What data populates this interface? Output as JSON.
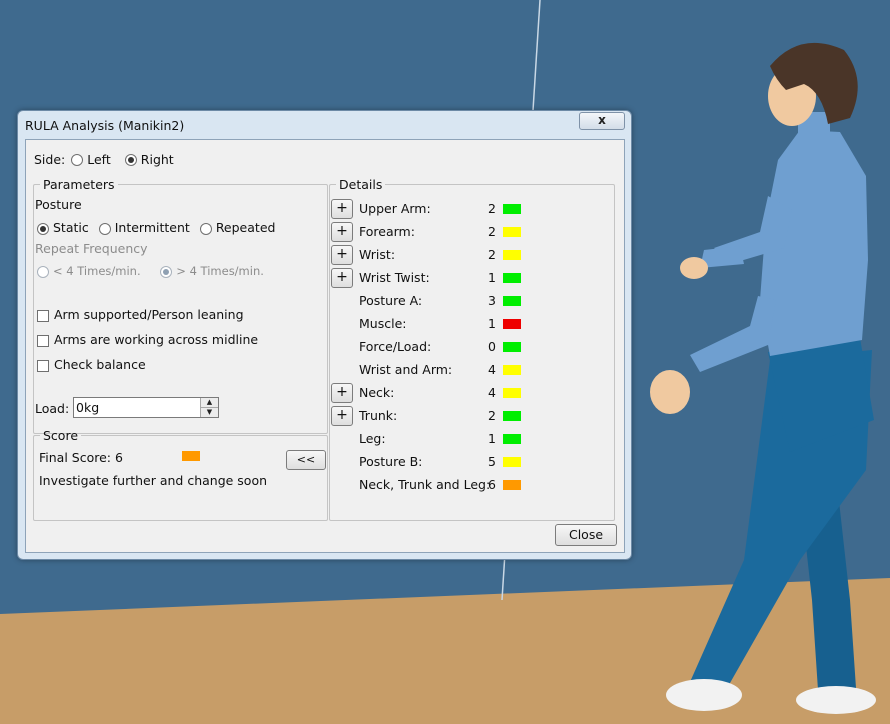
{
  "window": {
    "title": "RULA Analysis (Manikin2)",
    "close_glyph": "x"
  },
  "side": {
    "label": "Side:",
    "options": [
      "Left",
      "Right"
    ],
    "selected": "Right"
  },
  "parameters": {
    "legend": "Parameters",
    "posture_label": "Posture",
    "posture_options": [
      "Static",
      "Intermittent",
      "Repeated"
    ],
    "posture_selected": "Static",
    "repeat_frequency_label": "Repeat Frequency",
    "frequency_options": [
      "< 4 Times/min.",
      "> 4 Times/min."
    ],
    "frequency_selected": "> 4 Times/min.",
    "checkboxes": [
      {
        "label": "Arm supported/Person leaning",
        "checked": false
      },
      {
        "label": "Arms are working across midline",
        "checked": false
      },
      {
        "label": "Check balance",
        "checked": false
      }
    ],
    "load_label": "Load:",
    "load_value": "0kg"
  },
  "score": {
    "legend": "Score",
    "final_label": "Final Score: 6",
    "final_color": "#ff9900",
    "message": "Investigate further and change soon",
    "collapse_button": "<<"
  },
  "details": {
    "legend": "Details",
    "rows": [
      {
        "label": "Upper Arm:",
        "value": "2",
        "color": "#00ee00",
        "expandable": true
      },
      {
        "label": "Forearm:",
        "value": "2",
        "color": "#ffff00",
        "expandable": true
      },
      {
        "label": "Wrist:",
        "value": "2",
        "color": "#ffff00",
        "expandable": true
      },
      {
        "label": "Wrist Twist:",
        "value": "1",
        "color": "#00ee00",
        "expandable": true
      },
      {
        "label": "Posture A:",
        "value": "3",
        "color": "#00ee00",
        "expandable": false
      },
      {
        "label": "Muscle:",
        "value": "1",
        "color": "#ee0000",
        "expandable": false
      },
      {
        "label": "Force/Load:",
        "value": "0",
        "color": "#00ee00",
        "expandable": false
      },
      {
        "label": "Wrist and Arm:",
        "value": "4",
        "color": "#ffff00",
        "expandable": false
      },
      {
        "label": "Neck:",
        "value": "4",
        "color": "#ffff00",
        "expandable": true
      },
      {
        "label": "Trunk:",
        "value": "2",
        "color": "#00ee00",
        "expandable": true
      },
      {
        "label": "Leg:",
        "value": "1",
        "color": "#00ee00",
        "expandable": false
      },
      {
        "label": "Posture B:",
        "value": "5",
        "color": "#ffff00",
        "expandable": false
      },
      {
        "label": "Neck, Trunk and Leg:",
        "value": "6",
        "color": "#ff9900",
        "expandable": false
      }
    ],
    "expand_glyph": "+"
  },
  "footer": {
    "close_label": "Close"
  },
  "colors": {
    "wall": "#3f6a8e",
    "floor": "#c79d68",
    "shirt": "#6f9fd0",
    "pants": "#1b6a9d",
    "skin": "#f0c9a0",
    "hair": "#4a3528"
  }
}
